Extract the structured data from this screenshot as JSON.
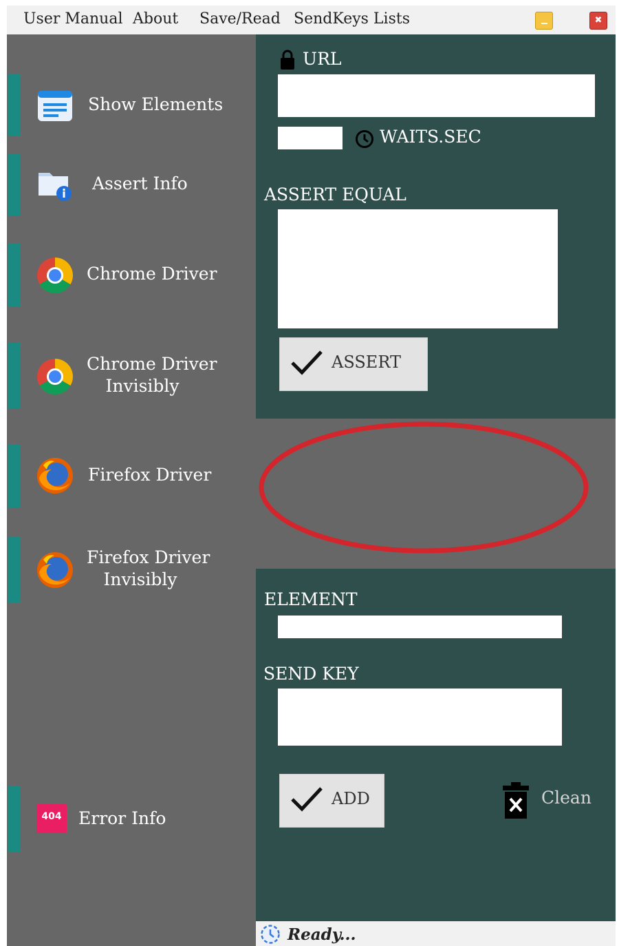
{
  "menubar": {
    "items": [
      "User Manual",
      "About",
      "Save/Read",
      "SendKeys Lists"
    ],
    "minimize_glyph": "",
    "close_glyph": "✖"
  },
  "sidebar": {
    "items": [
      {
        "label": "Show Elements",
        "icon": "document-list-icon"
      },
      {
        "label": "Assert Info",
        "icon": "folder-info-icon"
      },
      {
        "label": "Chrome Driver",
        "icon": "chrome-icon"
      },
      {
        "label_line1": "Chrome Driver",
        "label_line2": "Invisibly",
        "icon": "chrome-icon"
      },
      {
        "label": "Firefox Driver",
        "icon": "firefox-icon"
      },
      {
        "label_line1": "Firefox Driver",
        "label_line2": "Invisibly",
        "icon": "firefox-icon"
      },
      {
        "label": "Error Info",
        "icon": "error-404-icon",
        "badge": "404"
      }
    ]
  },
  "top_panel": {
    "url_label": "URL",
    "url_value": "",
    "waits_value": "",
    "waits_label": "WAITS.SEC",
    "assert_equal_label": "ASSERT EQUAL",
    "assert_equal_value": "",
    "assert_button": "ASSERT"
  },
  "bottom_panel": {
    "element_label": "ELEMENT",
    "element_value": "",
    "send_key_label": "SEND KEY",
    "send_key_value": "",
    "add_button": "ADD",
    "clean_button": "Clean"
  },
  "status_bar": {
    "text": "Ready..."
  },
  "colors": {
    "sidebar_bg": "#676767",
    "panel_bg": "#2f4f4d",
    "accent": "#1a8a82",
    "highlight_ellipse": "#d3252b"
  }
}
